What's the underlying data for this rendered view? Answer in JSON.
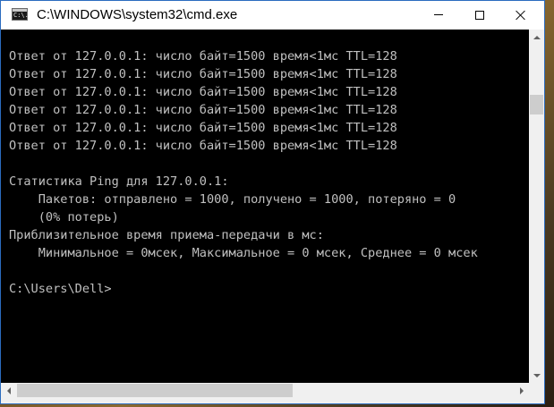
{
  "window": {
    "title": "C:\\WINDOWS\\system32\\cmd.exe",
    "icon_text": "C:\\."
  },
  "controls": {
    "minimize": "minimize-icon",
    "maximize": "maximize-icon",
    "close": "close-icon"
  },
  "console": {
    "lines": [
      "Ответ от 127.0.0.1: число байт=1500 время<1мс TTL=128",
      "Ответ от 127.0.0.1: число байт=1500 время<1мс TTL=128",
      "Ответ от 127.0.0.1: число байт=1500 время<1мс TTL=128",
      "Ответ от 127.0.0.1: число байт=1500 время<1мс TTL=128",
      "Ответ от 127.0.0.1: число байт=1500 время<1мс TTL=128",
      "Ответ от 127.0.0.1: число байт=1500 время<1мс TTL=128",
      "",
      "Статистика Ping для 127.0.0.1:",
      "    Пакетов: отправлено = 1000, получено = 1000, потеряно = 0",
      "    (0% потерь)",
      "Приблизительное время приема-передачи в мс:",
      "    Минимальное = 0мсек, Максимальное = 0 мсек, Среднее = 0 мсек",
      "",
      "C:\\Users\\Dell>"
    ]
  },
  "colors": {
    "console_background": "#000000",
    "console_text": "#c0c0c0",
    "window_border": "#2b6cbf",
    "scrollbar": "#f0f0f0"
  }
}
